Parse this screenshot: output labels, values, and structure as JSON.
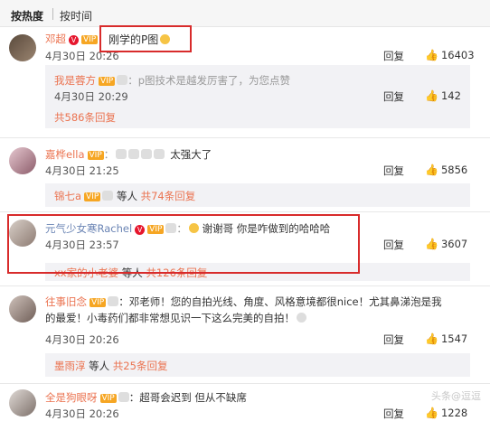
{
  "sort": {
    "hot": "按热度",
    "time": "按时间"
  },
  "c1": {
    "name": "邓超",
    "text": "刚学的P图",
    "time": "4月30日 20:26",
    "reply": "回复",
    "likes": "16403",
    "sub": {
      "name": "我是蓉方",
      "text": "：p图技术是越发厉害了，为您点赞",
      "time": "4月30日 20:29",
      "reply": "回复",
      "likes": "142"
    },
    "more": "共586条回复"
  },
  "c2": {
    "name": "嘉桦ella",
    "text": "太强大了",
    "time": "4月30日 21:25",
    "reply": "回复",
    "likes": "5856",
    "sub": {
      "name": "锦七a",
      "rest": "等人",
      "more": "共74条回复"
    }
  },
  "c3": {
    "name": "元气少女寒Rachel",
    "text": "谢谢哥 你是咋做到的哈哈哈",
    "time": "4月30日 23:57",
    "reply": "回复",
    "likes": "3607",
    "sub": {
      "name": "xx家的小老婆",
      "rest": "等人",
      "more": "共126条回复"
    }
  },
  "c4": {
    "name": "往事旧念",
    "text": "：邓老师！您的自拍光线、角度、风格意境都很nice！尤其鼻涕泡是我",
    "text2": "的最爱！小毒药们都非常想见识一下这么完美的自拍！",
    "time": "4月30日 20:26",
    "reply": "回复",
    "likes": "1547",
    "sub": {
      "name": "墨雨淳",
      "rest": "等人",
      "more": "共25条回复"
    }
  },
  "c5": {
    "name": "全是狗眼呀",
    "text": "：超哥会迟到 但从不缺席",
    "time": "4月30日 20:26",
    "reply": "回复",
    "likes": "1228"
  },
  "watermark": "头条@逗逗",
  "colors": {
    "accent": "#eb7350",
    "highlight": "#d82b2b"
  }
}
